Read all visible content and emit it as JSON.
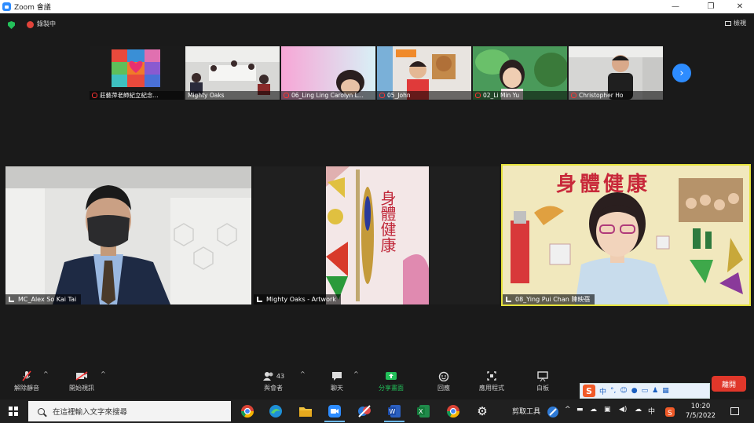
{
  "titlebar": {
    "title": "Zoom 會議",
    "minimize": "—",
    "restore": "❐",
    "close": "✕"
  },
  "meeting": {
    "recording_label": "錄製中",
    "view_label": "檢視"
  },
  "thumbnails": [
    {
      "name": "莊藝萍老師紀立紀念..."
    },
    {
      "name": "Mighty Oaks"
    },
    {
      "name": "06_Ling Ling Carolyn L..."
    },
    {
      "name": "05_John"
    },
    {
      "name": "02_Li Min Yu"
    },
    {
      "name": "Christopher Ho"
    }
  ],
  "next_page": "›",
  "tiles": [
    {
      "name": "MC_Alex So Kai Tai"
    },
    {
      "name": "Mighty Oaks - Artwork"
    },
    {
      "name": "08_Ying Pui Chan 陳映蓓"
    }
  ],
  "artwork": {
    "poster_title": "身體健康",
    "vertical_text": "身體健康"
  },
  "toolbar": {
    "unmute": "解除靜音",
    "start_video": "開始視訊",
    "participants": "與會者",
    "participants_count": "43",
    "chat": "聊天",
    "share_screen": "分享畫面",
    "reactions": "回應",
    "apps": "應用程式",
    "whiteboard": "白板",
    "leave": "離開"
  },
  "ime": {
    "mode": "中"
  },
  "taskbar": {
    "search_placeholder": "在這裡輸入文字來搜尋",
    "snipping_tool": "剪取工具",
    "input_mode": "中",
    "time": "10:20",
    "date": "7/5/2022"
  },
  "colors": {
    "zoom_blue": "#2d8cff",
    "share_green": "#23c05a",
    "leave_red": "#e0372a",
    "active_speaker": "#e6e23b"
  }
}
